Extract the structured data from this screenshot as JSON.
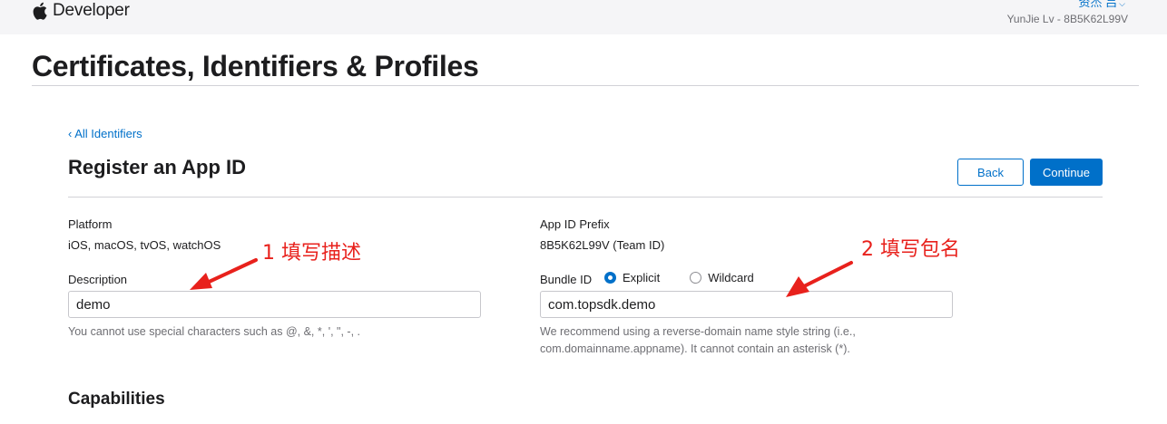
{
  "header": {
    "brand_text": "Developer",
    "account_name": "资杰 吕",
    "team_line": "YunJie Lv - 8B5K62L99V"
  },
  "page": {
    "title": "Certificates, Identifiers & Profiles",
    "back_link": "‹ All Identifiers",
    "section_title": "Register an App ID",
    "back_button": "Back",
    "continue_button": "Continue"
  },
  "form": {
    "platform_label": "Platform",
    "platform_value": "iOS, macOS, tvOS, watchOS",
    "description_label": "Description",
    "description_value": "demo",
    "description_hint": "You cannot use special characters such as @, &, *, ', \", -, .",
    "prefix_label": "App ID Prefix",
    "prefix_value": "8B5K62L99V (Team ID)",
    "bundle_label": "Bundle ID",
    "bundle_options": [
      "Explicit",
      "Wildcard"
    ],
    "bundle_selected": "Explicit",
    "bundle_value": "com.topsdk.demo",
    "bundle_hint_1": "We recommend using a reverse-domain name style string (i.e.,",
    "bundle_hint_2": "com.domainname.appname). It cannot contain an asterisk (*).",
    "capabilities_title": "Capabilities"
  },
  "annotations": {
    "note_1": "1 填写描述",
    "note_2": "2 填写包名"
  },
  "colors": {
    "accent": "#0070c9",
    "annotation": "#e8211c",
    "topbar": "#f5f5f7"
  },
  "icons": {
    "brand": "apple-logo-icon",
    "account_menu": "chevron-down-icon"
  }
}
